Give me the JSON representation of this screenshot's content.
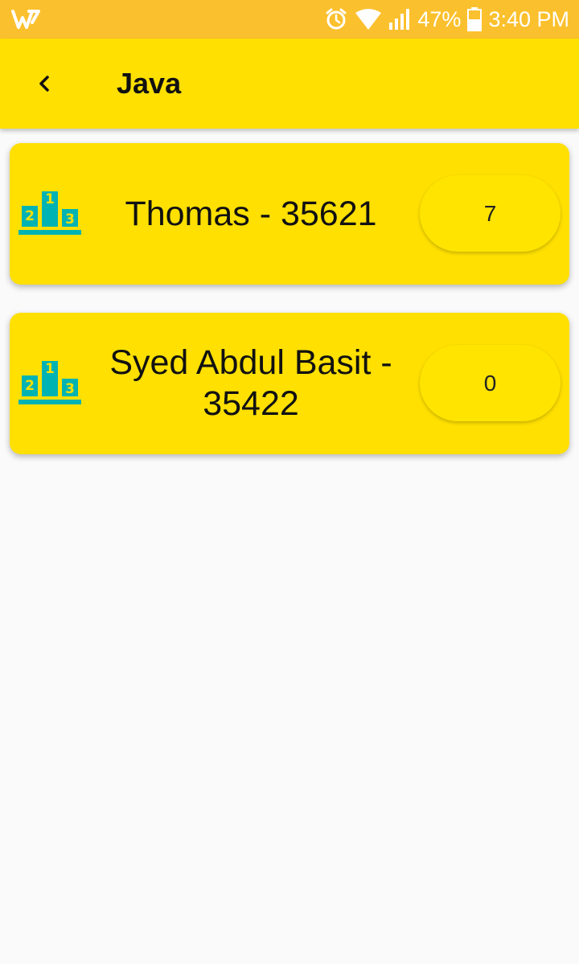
{
  "status_bar": {
    "battery": "47%",
    "time": "3:40 PM",
    "icons": [
      "app-logo-icon",
      "alarm-icon",
      "wifi-icon",
      "signal-icon",
      "battery-icon"
    ]
  },
  "header": {
    "title": "Java",
    "back_icon": "chevron-left-icon"
  },
  "colors": {
    "status_bar": "#fbc02d",
    "accent": "#ffe000",
    "podium": "#00b3b3"
  },
  "entries": [
    {
      "name": "Thomas - 35621",
      "score": "7",
      "icon": "podium-icon"
    },
    {
      "name": "Syed Abdul Basit - 35422",
      "score": "0",
      "icon": "podium-icon"
    }
  ]
}
